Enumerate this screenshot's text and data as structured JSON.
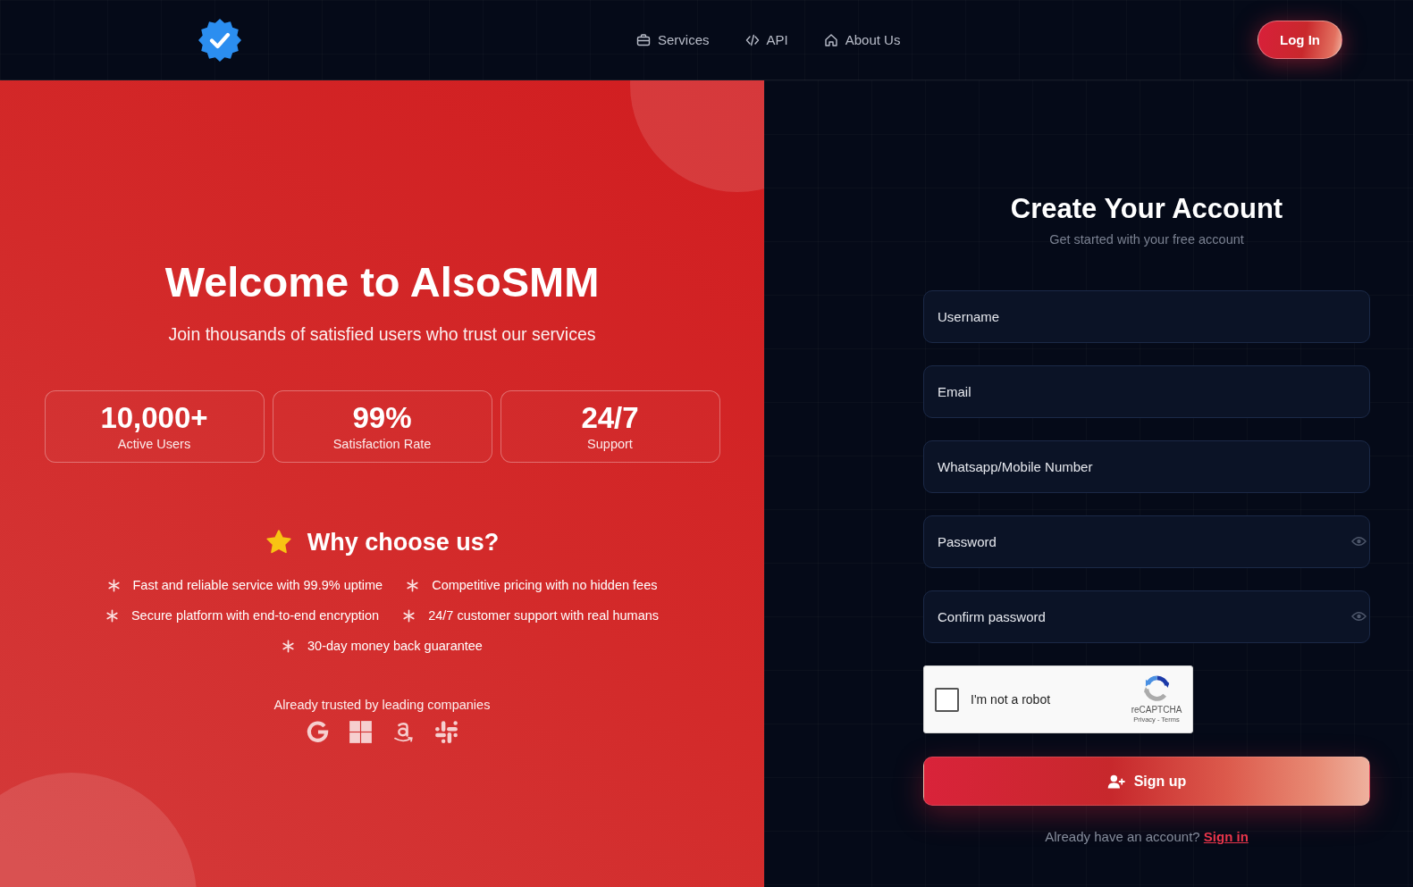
{
  "header": {
    "nav": [
      {
        "label": "Services"
      },
      {
        "label": "API"
      },
      {
        "label": "About Us"
      }
    ],
    "login_button": "Log In"
  },
  "hero": {
    "title": "Welcome to AlsoSMM",
    "subtitle": "Join thousands of satisfied users who trust our services",
    "stats": [
      {
        "value": "10,000+",
        "label": "Active Users"
      },
      {
        "value": "99%",
        "label": "Satisfaction Rate"
      },
      {
        "value": "24/7",
        "label": "Support"
      }
    ],
    "why_title": "Why choose us?",
    "features": [
      "Fast and reliable service with 99.9% uptime",
      "Competitive pricing with no hidden fees",
      "Secure platform with end-to-end encryption",
      "24/7 customer support with real humans",
      "30-day money back guarantee"
    ],
    "trusted_text": "Already trusted by leading companies"
  },
  "signup": {
    "title": "Create Your Account",
    "subtitle": "Get started with your free account",
    "fields": [
      {
        "kind": "text",
        "placeholder": "Username"
      },
      {
        "kind": "text",
        "placeholder": "Email"
      },
      {
        "kind": "text",
        "placeholder": "Whatsapp/Mobile Number"
      },
      {
        "kind": "password",
        "placeholder": "Password"
      },
      {
        "kind": "password",
        "placeholder": "Confirm password"
      }
    ],
    "captcha": {
      "label": "I'm not a robot",
      "checked": false,
      "brand": "reCAPTCHA",
      "links": "Privacy - Terms"
    },
    "submit": "Sign up",
    "footer": {
      "text": "Already have an account?",
      "link": "Sign in"
    }
  }
}
